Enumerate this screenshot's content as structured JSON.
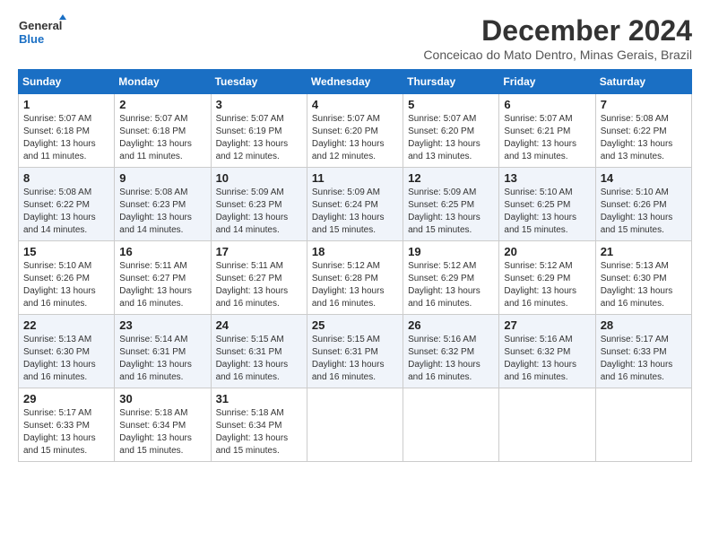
{
  "logo": {
    "line1": "General",
    "line2": "Blue"
  },
  "title": "December 2024",
  "subtitle": "Conceicao do Mato Dentro, Minas Gerais, Brazil",
  "weekdays": [
    "Sunday",
    "Monday",
    "Tuesday",
    "Wednesday",
    "Thursday",
    "Friday",
    "Saturday"
  ],
  "weeks": [
    [
      {
        "day": "1",
        "info": "Sunrise: 5:07 AM\nSunset: 6:18 PM\nDaylight: 13 hours and 11 minutes."
      },
      {
        "day": "2",
        "info": "Sunrise: 5:07 AM\nSunset: 6:18 PM\nDaylight: 13 hours and 11 minutes."
      },
      {
        "day": "3",
        "info": "Sunrise: 5:07 AM\nSunset: 6:19 PM\nDaylight: 13 hours and 12 minutes."
      },
      {
        "day": "4",
        "info": "Sunrise: 5:07 AM\nSunset: 6:20 PM\nDaylight: 13 hours and 12 minutes."
      },
      {
        "day": "5",
        "info": "Sunrise: 5:07 AM\nSunset: 6:20 PM\nDaylight: 13 hours and 13 minutes."
      },
      {
        "day": "6",
        "info": "Sunrise: 5:07 AM\nSunset: 6:21 PM\nDaylight: 13 hours and 13 minutes."
      },
      {
        "day": "7",
        "info": "Sunrise: 5:08 AM\nSunset: 6:22 PM\nDaylight: 13 hours and 13 minutes."
      }
    ],
    [
      {
        "day": "8",
        "info": "Sunrise: 5:08 AM\nSunset: 6:22 PM\nDaylight: 13 hours and 14 minutes."
      },
      {
        "day": "9",
        "info": "Sunrise: 5:08 AM\nSunset: 6:23 PM\nDaylight: 13 hours and 14 minutes."
      },
      {
        "day": "10",
        "info": "Sunrise: 5:09 AM\nSunset: 6:23 PM\nDaylight: 13 hours and 14 minutes."
      },
      {
        "day": "11",
        "info": "Sunrise: 5:09 AM\nSunset: 6:24 PM\nDaylight: 13 hours and 15 minutes."
      },
      {
        "day": "12",
        "info": "Sunrise: 5:09 AM\nSunset: 6:25 PM\nDaylight: 13 hours and 15 minutes."
      },
      {
        "day": "13",
        "info": "Sunrise: 5:10 AM\nSunset: 6:25 PM\nDaylight: 13 hours and 15 minutes."
      },
      {
        "day": "14",
        "info": "Sunrise: 5:10 AM\nSunset: 6:26 PM\nDaylight: 13 hours and 15 minutes."
      }
    ],
    [
      {
        "day": "15",
        "info": "Sunrise: 5:10 AM\nSunset: 6:26 PM\nDaylight: 13 hours and 16 minutes."
      },
      {
        "day": "16",
        "info": "Sunrise: 5:11 AM\nSunset: 6:27 PM\nDaylight: 13 hours and 16 minutes."
      },
      {
        "day": "17",
        "info": "Sunrise: 5:11 AM\nSunset: 6:27 PM\nDaylight: 13 hours and 16 minutes."
      },
      {
        "day": "18",
        "info": "Sunrise: 5:12 AM\nSunset: 6:28 PM\nDaylight: 13 hours and 16 minutes."
      },
      {
        "day": "19",
        "info": "Sunrise: 5:12 AM\nSunset: 6:29 PM\nDaylight: 13 hours and 16 minutes."
      },
      {
        "day": "20",
        "info": "Sunrise: 5:12 AM\nSunset: 6:29 PM\nDaylight: 13 hours and 16 minutes."
      },
      {
        "day": "21",
        "info": "Sunrise: 5:13 AM\nSunset: 6:30 PM\nDaylight: 13 hours and 16 minutes."
      }
    ],
    [
      {
        "day": "22",
        "info": "Sunrise: 5:13 AM\nSunset: 6:30 PM\nDaylight: 13 hours and 16 minutes."
      },
      {
        "day": "23",
        "info": "Sunrise: 5:14 AM\nSunset: 6:31 PM\nDaylight: 13 hours and 16 minutes."
      },
      {
        "day": "24",
        "info": "Sunrise: 5:15 AM\nSunset: 6:31 PM\nDaylight: 13 hours and 16 minutes."
      },
      {
        "day": "25",
        "info": "Sunrise: 5:15 AM\nSunset: 6:31 PM\nDaylight: 13 hours and 16 minutes."
      },
      {
        "day": "26",
        "info": "Sunrise: 5:16 AM\nSunset: 6:32 PM\nDaylight: 13 hours and 16 minutes."
      },
      {
        "day": "27",
        "info": "Sunrise: 5:16 AM\nSunset: 6:32 PM\nDaylight: 13 hours and 16 minutes."
      },
      {
        "day": "28",
        "info": "Sunrise: 5:17 AM\nSunset: 6:33 PM\nDaylight: 13 hours and 16 minutes."
      }
    ],
    [
      {
        "day": "29",
        "info": "Sunrise: 5:17 AM\nSunset: 6:33 PM\nDaylight: 13 hours and 15 minutes."
      },
      {
        "day": "30",
        "info": "Sunrise: 5:18 AM\nSunset: 6:34 PM\nDaylight: 13 hours and 15 minutes."
      },
      {
        "day": "31",
        "info": "Sunrise: 5:18 AM\nSunset: 6:34 PM\nDaylight: 13 hours and 15 minutes."
      },
      null,
      null,
      null,
      null
    ]
  ]
}
